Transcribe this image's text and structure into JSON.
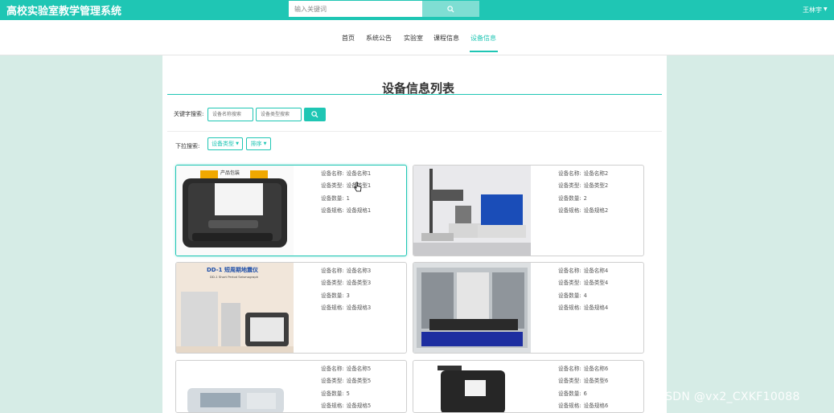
{
  "header": {
    "app_title": "高校实验室教学管理系统",
    "search_placeholder": "输入关键词",
    "user_name": "王林宇",
    "colors": {
      "accent": "#1fc6b4",
      "page_bg": "#d6ece6"
    }
  },
  "nav": {
    "items": [
      {
        "label": "首页",
        "active": false
      },
      {
        "label": "系统公告",
        "active": false
      },
      {
        "label": "实验室",
        "active": false
      },
      {
        "label": "课程信息",
        "active": false
      },
      {
        "label": "设备信息",
        "active": true
      }
    ]
  },
  "page": {
    "title": "设备信息列表",
    "keyword_label": "关键字搜索:",
    "name_placeholder": "设备名称搜索",
    "type_placeholder": "设备类型搜索",
    "dropdown_label": "下拉搜索:",
    "type_dropdown": "设备类型",
    "sort_dropdown": "排序"
  },
  "cards": [
    {
      "name_label": "设备名称:",
      "name": "设备名称1",
      "type_label": "设备类型:",
      "type": "设备类型1",
      "qty_label": "设备数量:",
      "qty": "1",
      "spec_label": "设备规格:",
      "spec": "设备规格1",
      "image_caption": "产品包装"
    },
    {
      "name_label": "设备名称:",
      "name": "设备名称2",
      "type_label": "设备类型:",
      "type": "设备类型2",
      "qty_label": "设备数量:",
      "qty": "2",
      "spec_label": "设备规格:",
      "spec": "设备规格2"
    },
    {
      "name_label": "设备名称:",
      "name": "设备名称3",
      "type_label": "设备类型:",
      "type": "设备类型3",
      "qty_label": "设备数量:",
      "qty": "3",
      "spec_label": "设备规格:",
      "spec": "设备规格3",
      "image_caption": "DD-1 短周期地震仪",
      "image_subcaption": "DD-1 Short Period Seismograph"
    },
    {
      "name_label": "设备名称:",
      "name": "设备名称4",
      "type_label": "设备类型:",
      "type": "设备类型4",
      "qty_label": "设备数量:",
      "qty": "4",
      "spec_label": "设备规格:",
      "spec": "设备规格4"
    },
    {
      "name_label": "设备名称:",
      "name": "设备名称5",
      "type_label": "设备类型:",
      "type": "设备类型5",
      "qty_label": "设备数量:",
      "qty": "5",
      "spec_label": "设备规格:",
      "spec": "设备规格5"
    },
    {
      "name_label": "设备名称:",
      "name": "设备名称6",
      "type_label": "设备类型:",
      "type": "设备类型6",
      "qty_label": "设备数量:",
      "qty": "6",
      "spec_label": "设备规格:",
      "spec": "设备规格6"
    }
  ],
  "watermark": "CSDN @vx2_CXKF10088"
}
